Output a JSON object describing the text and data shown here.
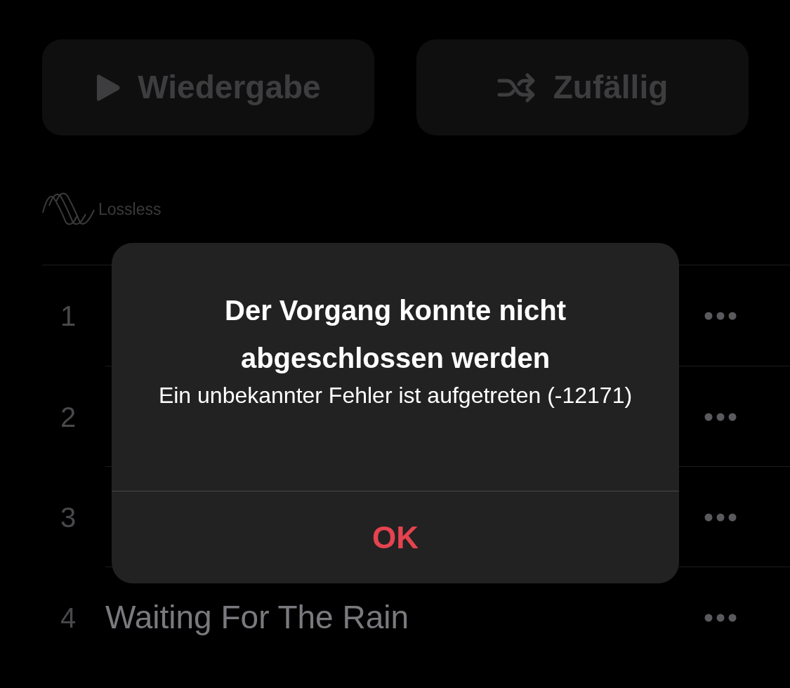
{
  "actions": [
    {
      "kind": "play",
      "label": "Wiedergabe"
    },
    {
      "kind": "shuffle",
      "label": "Zufällig"
    }
  ],
  "badge": {
    "label": "Lossless"
  },
  "tracks": [
    {
      "number": "1"
    },
    {
      "number": "2"
    },
    {
      "number": "3"
    },
    {
      "number": "4",
      "title": "Waiting For The Rain"
    }
  ],
  "alert": {
    "title": "Der Vorgang konnte nicht abgeschlossen werden",
    "message": "Ein unbekannter Fehler ist aufgetreten (-12171)",
    "button": "OK"
  }
}
